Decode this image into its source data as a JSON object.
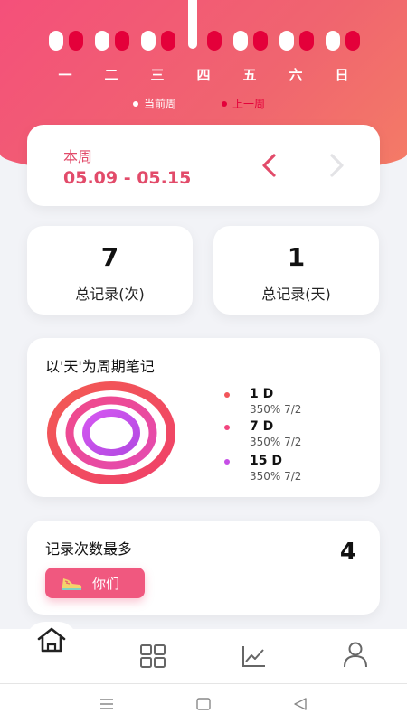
{
  "header": {
    "days": [
      "一",
      "二",
      "三",
      "四",
      "五",
      "六",
      "日"
    ],
    "legend": {
      "current_label": "当前周",
      "previous_label": "上一周"
    },
    "colors": {
      "current": "#ffffff",
      "previous": "#e4003a",
      "accent": "#e24b6a"
    }
  },
  "week_card": {
    "label": "本周",
    "range": "05.09 - 05.15",
    "prev_icon": "chevron-left-icon",
    "next_icon": "chevron-right-icon"
  },
  "stats": [
    {
      "value": "7",
      "label": "总记录(次)"
    },
    {
      "value": "1",
      "label": "总记录(天)"
    }
  ],
  "cycle": {
    "title": "以'天'为周期笔记",
    "items": [
      {
        "name": "1 D",
        "detail": "350%  7/2",
        "color": "#f2555a"
      },
      {
        "name": "7 D",
        "detail": "350%  7/2",
        "color": "#f2457e"
      },
      {
        "name": "15 D",
        "detail": "350%  7/2",
        "color": "#c64fe6"
      }
    ]
  },
  "most": {
    "title": "记录次数最多",
    "count": "4",
    "tag_label": "你们",
    "tag_icon": "sneaker-icon"
  },
  "tabbar": {
    "items": [
      "home-icon",
      "grid-icon",
      "chart-icon",
      "profile-icon"
    ],
    "active": "home-icon"
  },
  "system_nav": [
    "menu-icon",
    "home-square-icon",
    "back-triangle-icon"
  ]
}
